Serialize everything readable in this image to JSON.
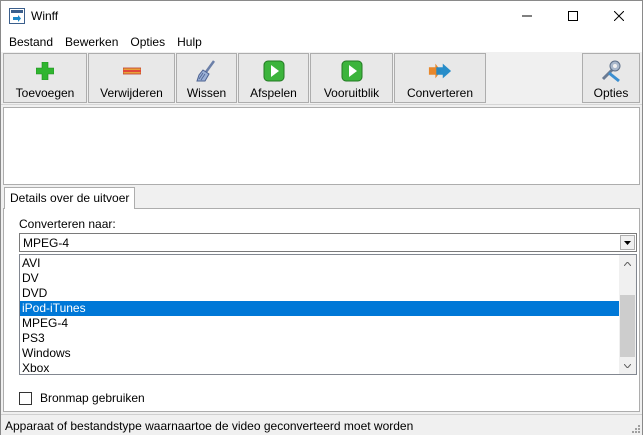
{
  "window": {
    "title": "Winff",
    "icon": "winff-app-icon",
    "controls": [
      "minimize-icon",
      "maximize-icon",
      "close-icon"
    ]
  },
  "menu": [
    "Bestand",
    "Bewerken",
    "Opties",
    "Hulp"
  ],
  "toolbar": {
    "add": {
      "label": "Toevoegen",
      "icon": "plus-icon"
    },
    "remove": {
      "label": "Verwijderen",
      "icon": "minus-icon"
    },
    "clear": {
      "label": "Wissen",
      "icon": "broom-icon"
    },
    "play": {
      "label": "Afspelen",
      "icon": "play-icon"
    },
    "preview": {
      "label": "Vooruitblik",
      "icon": "preview-play-icon"
    },
    "convert": {
      "label": "Converteren",
      "icon": "convert-arrows-icon"
    },
    "options": {
      "label": "Opties",
      "icon": "tools-icon"
    }
  },
  "tab": {
    "label": "Details over de uitvoer"
  },
  "output": {
    "convert_to_label": "Converteren naar:",
    "selected_value": "MPEG-4",
    "options": [
      "AVI",
      "DV",
      "DVD",
      "iPod-iTunes",
      "MPEG-4",
      "PS3",
      "Windows",
      "Xbox"
    ],
    "highlighted": "iPod-iTunes"
  },
  "checkbox": {
    "label": "Bronmap gebruiken",
    "checked": false
  },
  "status": {
    "text": "Apparaat of bestandstype waarnaartoe de video geconverteerd moet worden"
  },
  "colors": {
    "selection": "#0078d7",
    "plus": "#2fb52f",
    "minus": "#e0463a",
    "play": "#3cb43c",
    "convert": "#1e88c7"
  }
}
